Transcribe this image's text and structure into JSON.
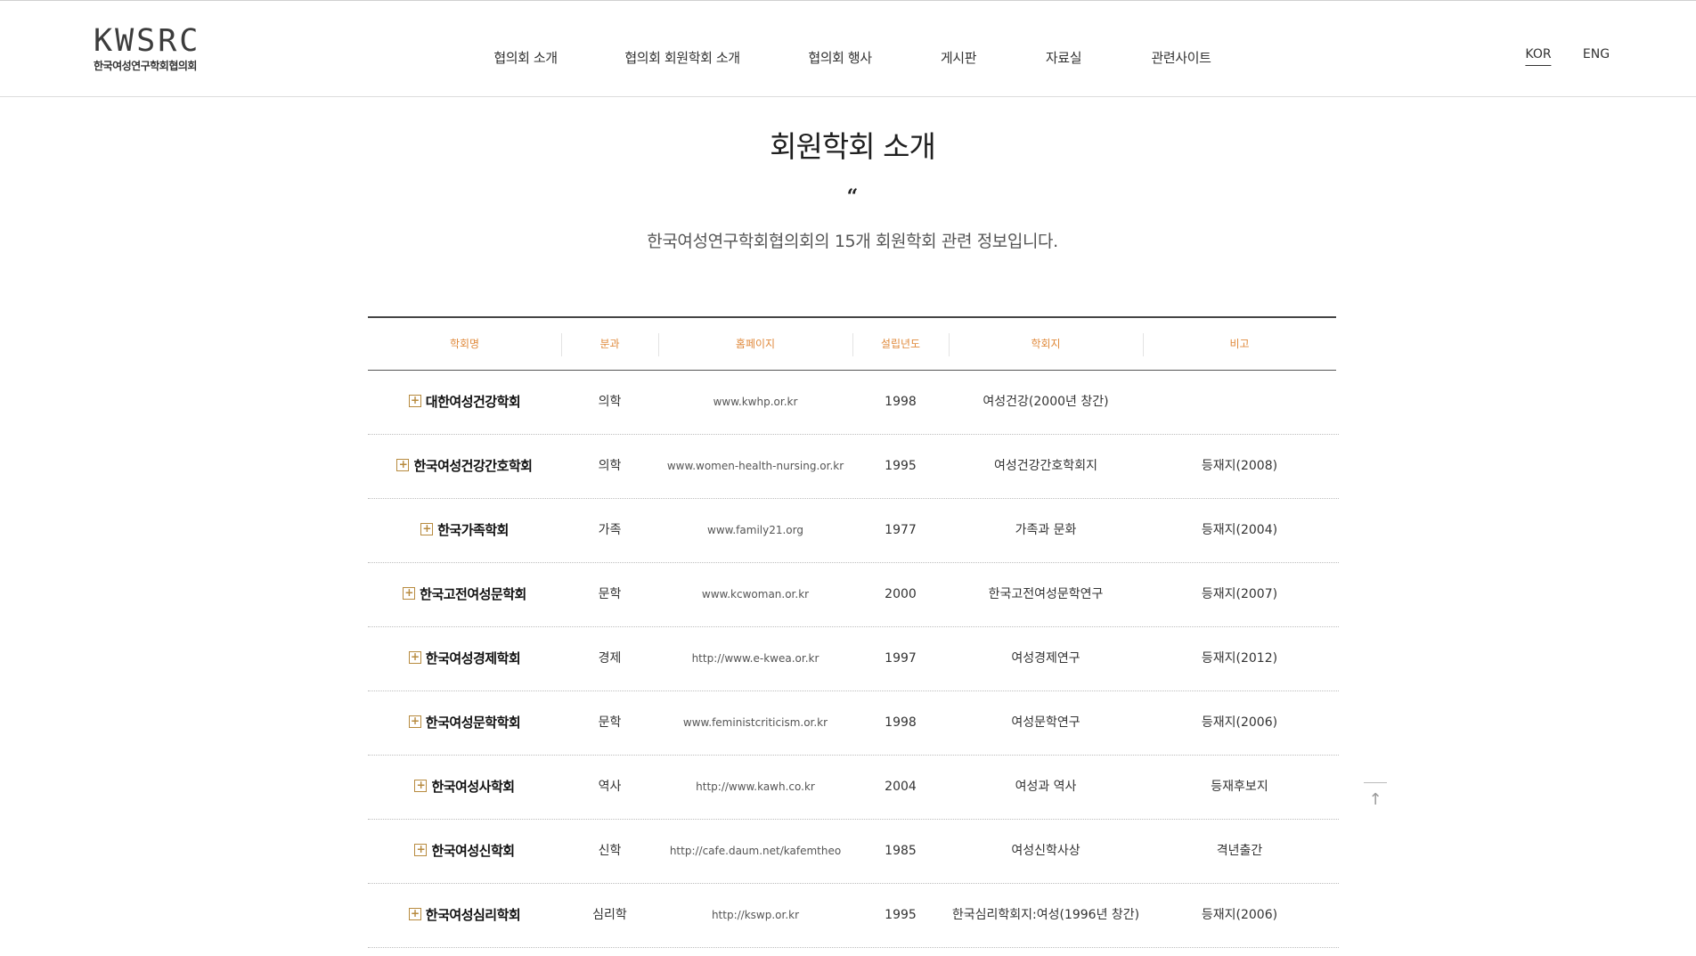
{
  "logo": {
    "mark": "KWSRC",
    "subtitle": "한국여성연구학회협의회"
  },
  "nav": [
    {
      "label": "협의회 소개"
    },
    {
      "label": "협의회 회원학회 소개"
    },
    {
      "label": "협의회 행사"
    },
    {
      "label": "게시판"
    },
    {
      "label": "자료실"
    },
    {
      "label": "관련사이트"
    }
  ],
  "lang": {
    "kor": "KOR",
    "eng": "ENG",
    "active": "KOR"
  },
  "page": {
    "title": "회원학회 소개",
    "quote_mark": "“",
    "intro": "한국여성연구학회협의회의 15개 회원학회 관련 정보입니다."
  },
  "table": {
    "headers": [
      "학회명",
      "분과",
      "홈페이지",
      "설립년도",
      "학회지",
      "비고"
    ],
    "rows": [
      {
        "name": "대한여성건강학회",
        "field": "의학",
        "url": "www.kwhp.or.kr",
        "year": "1998",
        "journal": "여성건강(2000년 창간)",
        "note": ""
      },
      {
        "name": "한국여성건강간호학회",
        "field": "의학",
        "url": "www.women-health-nursing.or.kr",
        "year": "1995",
        "journal": "여성건강간호학회지",
        "note": "등재지(2008)"
      },
      {
        "name": "한국가족학회",
        "field": "가족",
        "url": "www.family21.org",
        "year": "1977",
        "journal": "가족과 문화",
        "note": "등재지(2004)"
      },
      {
        "name": "한국고전여성문학회",
        "field": "문학",
        "url": "www.kcwoman.or.kr",
        "year": "2000",
        "journal": "한국고전여성문학연구",
        "note": "등재지(2007)"
      },
      {
        "name": "한국여성경제학회",
        "field": "경제",
        "url": "http://www.e-kwea.or.kr",
        "year": "1997",
        "journal": "여성경제연구",
        "note": "등재지(2012)"
      },
      {
        "name": "한국여성문학학회",
        "field": "문학",
        "url": "www.feministcriticism.or.kr",
        "year": "1998",
        "journal": "여성문학연구",
        "note": "등재지(2006)"
      },
      {
        "name": "한국여성사학회",
        "field": "역사",
        "url": "http://www.kawh.co.kr",
        "year": "2004",
        "journal": "여성과 역사",
        "note": "등재후보지"
      },
      {
        "name": "한국여성신학회",
        "field": "신학",
        "url": "http://cafe.daum.net/kafemtheo",
        "year": "1985",
        "journal": "여성신학사상",
        "note": "격년출간"
      },
      {
        "name": "한국여성심리학회",
        "field": "심리학",
        "url": "http://kswp.or.kr",
        "year": "1995",
        "journal": "한국심리학회지:여성(1996년 창간)",
        "note": "등재지(2006)"
      }
    ]
  },
  "icons": {
    "expand": "plus-box-icon",
    "scroll_top": "arrow-up-icon"
  },
  "colors": {
    "header_accent": "#e08a3c",
    "expand_icon": "#b78a3e"
  }
}
